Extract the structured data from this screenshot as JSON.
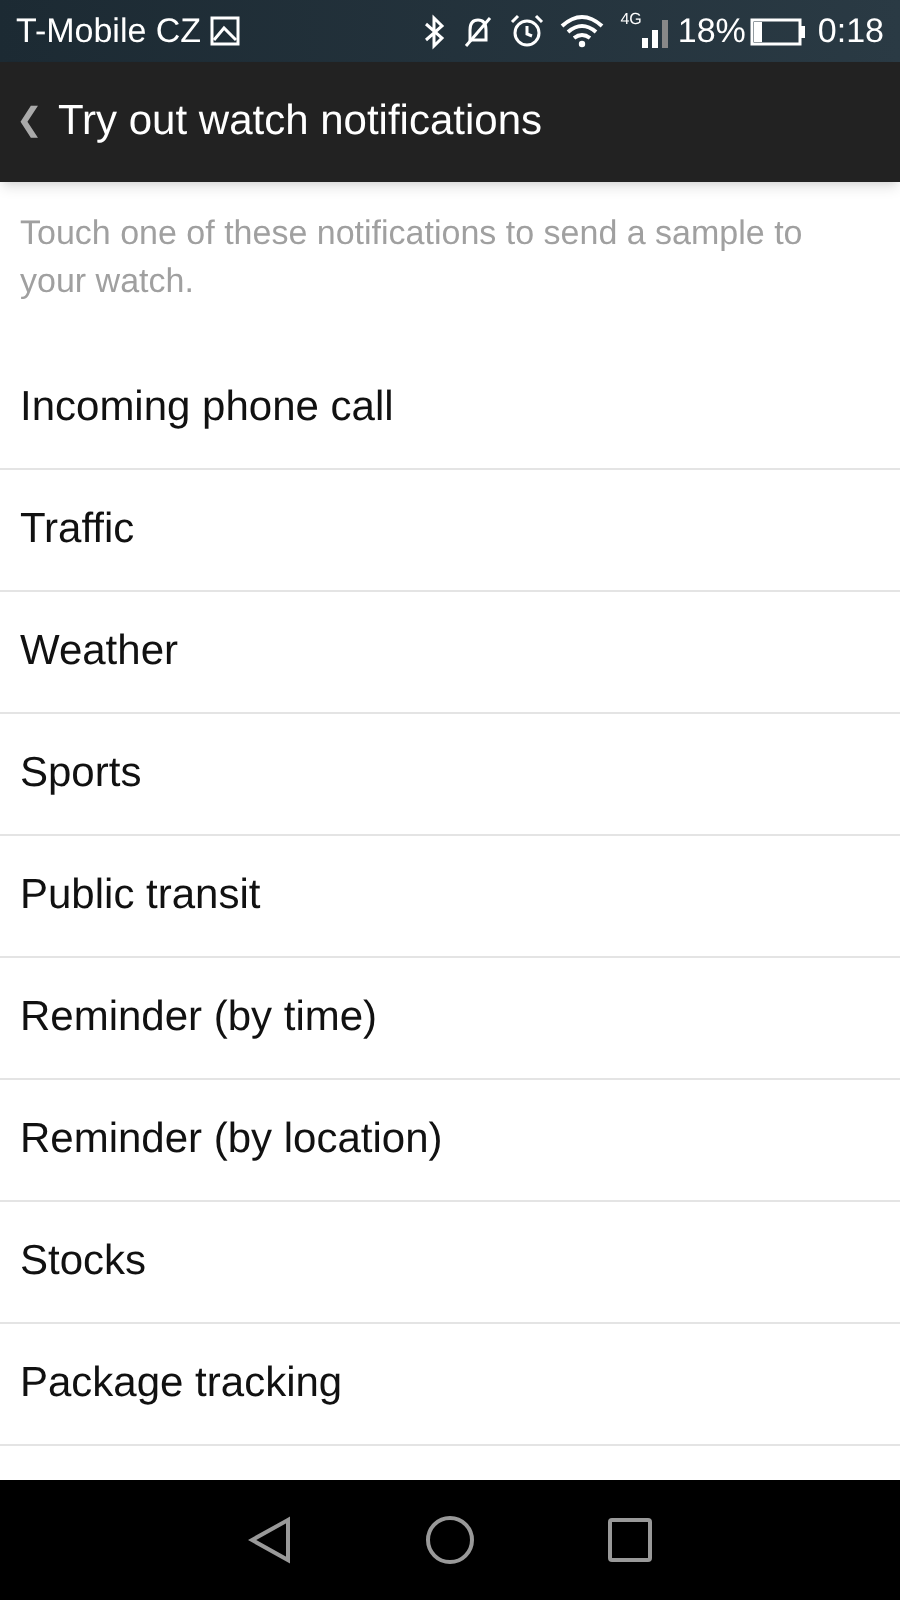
{
  "status_bar": {
    "carrier": "T-Mobile CZ",
    "network": "4G",
    "battery": "18%",
    "time": "0:18"
  },
  "app_bar": {
    "back": "❮",
    "title": "Try out watch notifications"
  },
  "description": "Touch one of these notifications to send a sample to your watch.",
  "items": [
    "Incoming phone call",
    "Traffic",
    "Weather",
    "Sports",
    "Public transit",
    "Reminder (by time)",
    "Reminder (by location)",
    "Stocks",
    "Package tracking"
  ]
}
